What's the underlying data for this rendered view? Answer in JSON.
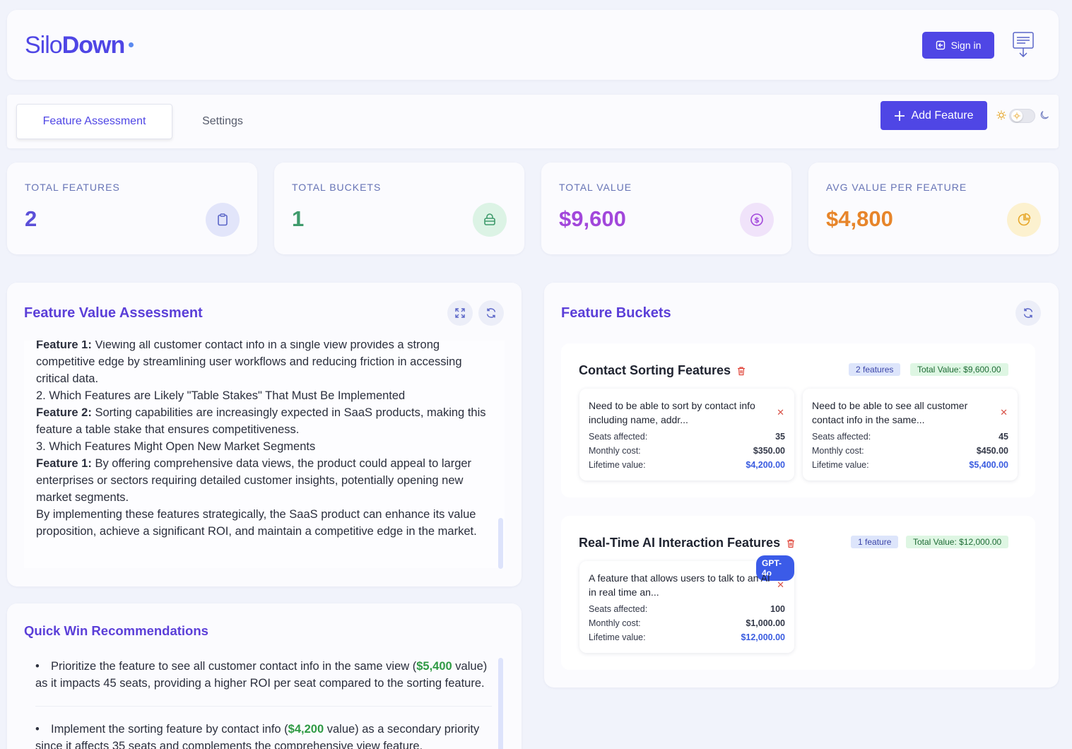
{
  "header": {
    "logo_part1": "Silo",
    "logo_part2": "Down",
    "signin_label": "Sign in"
  },
  "tabs": [
    {
      "label": "Feature Assessment",
      "active": true
    },
    {
      "label": "Settings",
      "active": false
    }
  ],
  "toolbar": {
    "add_feature_label": "Add Feature"
  },
  "stats": [
    {
      "label": "TOTAL FEATURES",
      "value": "2",
      "color": "#5b4fd8",
      "icon": "clipboard-icon"
    },
    {
      "label": "TOTAL BUCKETS",
      "value": "1",
      "color": "#3f9b6c",
      "icon": "bucket-icon"
    },
    {
      "label": "TOTAL VALUE",
      "value": "$9,600",
      "color": "#a247db",
      "icon": "dollar-icon"
    },
    {
      "label": "AVG VALUE PER FEATURE",
      "value": "$4,800",
      "color": "#e7852a",
      "icon": "pie-chart-icon"
    }
  ],
  "assessment": {
    "title": "Feature Value Assessment",
    "p1_label": "Feature 1:",
    "p1_text": " Viewing all customer contact info in a single view provides a strong competitive edge by streamlining user workflows and reducing friction in accessing critical data.",
    "h2": "2. Which Features are Likely \"Table Stakes\" That Must Be Implemented",
    "p2_label": "Feature 2:",
    "p2_text": " Sorting capabilities are increasingly expected in SaaS products, making this feature a table stake that ensures competitiveness.",
    "h3": "3. Which Features Might Open New Market Segments",
    "p3_label": "Feature 1:",
    "p3_text": " By offering comprehensive data views, the product could appeal to larger enterprises or sectors requiring detailed customer insights, potentially opening new market segments.",
    "closing": "By implementing these features strategically, the SaaS product can enhance its value proposition, achieve a significant ROI, and maintain a competitive edge in the market."
  },
  "quick_wins": {
    "title": "Quick Win Recommendations",
    "item1_pre": "Prioritize the feature to see all customer contact info in the same view (",
    "item1_money": "$5,400",
    "item1_post": " value) as it impacts 45 seats, providing a higher ROI per seat compared to the sorting feature.",
    "item2_pre": "Implement the sorting feature by contact info (",
    "item2_money": "$4,200",
    "item2_post": " value) as a secondary priority since it affects 35 seats and complements the comprehensive view feature."
  },
  "buckets": {
    "title": "Feature Buckets",
    "labels": {
      "seats": "Seats affected:",
      "monthly": "Monthly cost:",
      "lifetime": "Lifetime value:"
    },
    "items": [
      {
        "name": "Contact Sorting Features",
        "count": "2 features",
        "total": "Total Value: $9,600.00",
        "features": [
          {
            "desc": "Need to be able to sort by contact info including name, addr...",
            "seats": "35",
            "monthly": "$350.00",
            "lifetime": "$4,200.00"
          },
          {
            "desc": "Need to be able to see all customer contact info in the same...",
            "seats": "45",
            "monthly": "$450.00",
            "lifetime": "$5,400.00"
          }
        ]
      },
      {
        "name": "Real-Time AI Interaction Features",
        "count": "1 feature",
        "total": "Total Value: $12,000.00",
        "features": [
          {
            "desc": "A feature that allows users to talk to an AI in real time an...",
            "seats": "100",
            "monthly": "$1,000.00",
            "lifetime": "$12,000.00",
            "tag": "GPT-4o"
          }
        ]
      }
    ]
  }
}
